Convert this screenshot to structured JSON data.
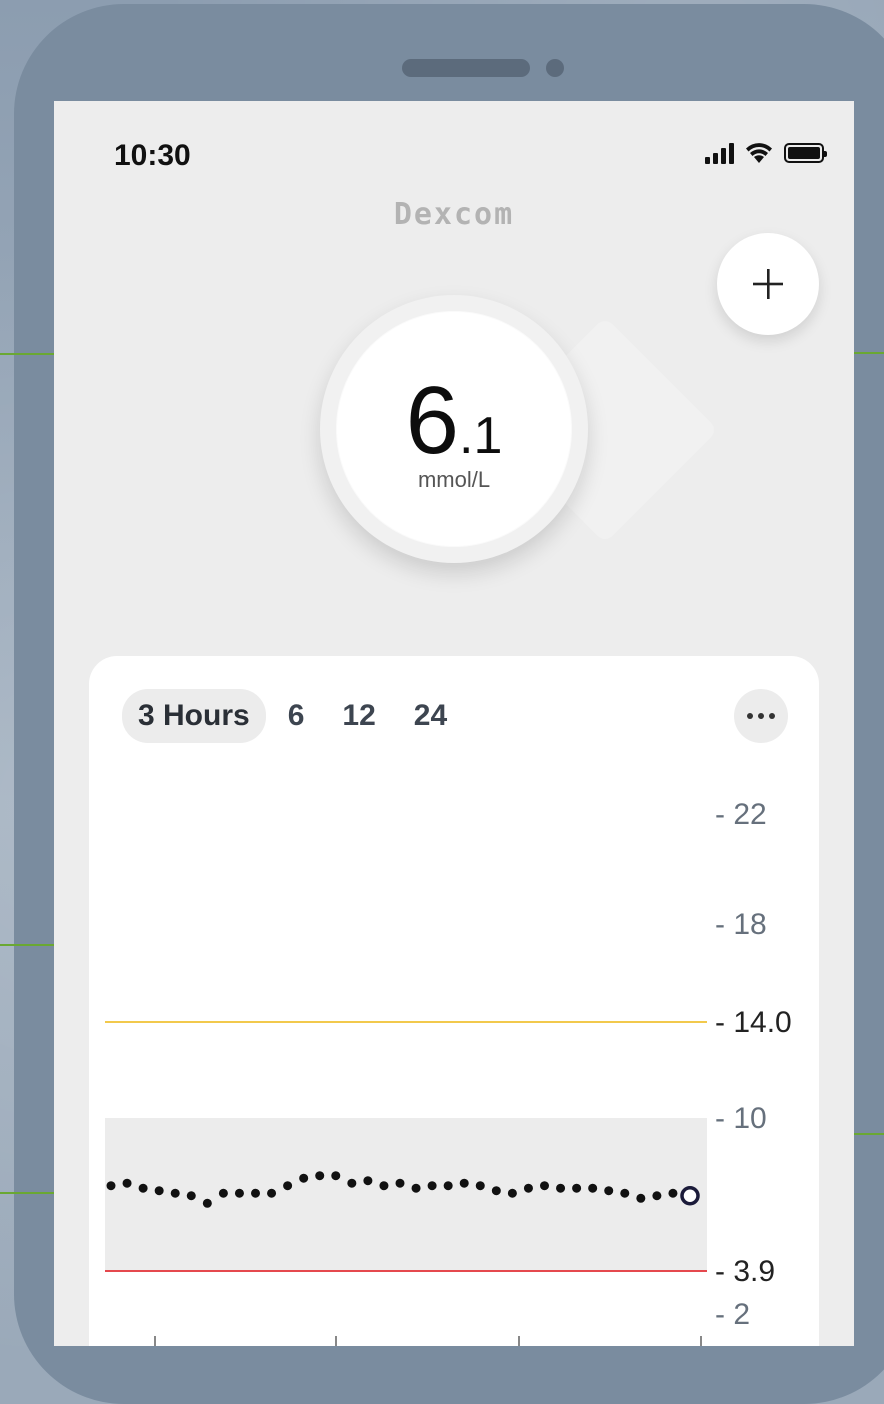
{
  "status_bar": {
    "time": "10:30"
  },
  "app": {
    "logo": "Dexcom"
  },
  "reading": {
    "value_int": "6",
    "value_dec": ".1",
    "unit": "mmol/L",
    "trend": "steady"
  },
  "add_button": {
    "label": "+"
  },
  "time_range": {
    "options": [
      "3 Hours",
      "6",
      "12",
      "24"
    ],
    "selected": "3 Hours"
  },
  "menu": {
    "label": "more-options"
  },
  "chart_data": {
    "type": "scatter",
    "ylabel": "mmol/L",
    "y_ticks": [
      "22",
      "18",
      "14.0",
      "10",
      "3.9",
      "2"
    ],
    "high_threshold": 14.0,
    "low_threshold": 3.9,
    "target_range": [
      3.9,
      10
    ],
    "colors": {
      "high": "#f2c94c",
      "low": "#e5484d",
      "target_band": "#ececec",
      "points": "#111111"
    },
    "values": [
      7.3,
      7.4,
      7.2,
      7.1,
      7.0,
      6.9,
      6.6,
      7.0,
      7.0,
      7.0,
      7.0,
      7.3,
      7.6,
      7.7,
      7.7,
      7.4,
      7.5,
      7.3,
      7.4,
      7.2,
      7.3,
      7.3,
      7.4,
      7.3,
      7.1,
      7.0,
      7.2,
      7.3,
      7.2,
      7.2,
      7.2,
      7.1,
      7.0,
      6.8,
      6.9,
      7.0
    ],
    "current_value": 6.9
  }
}
